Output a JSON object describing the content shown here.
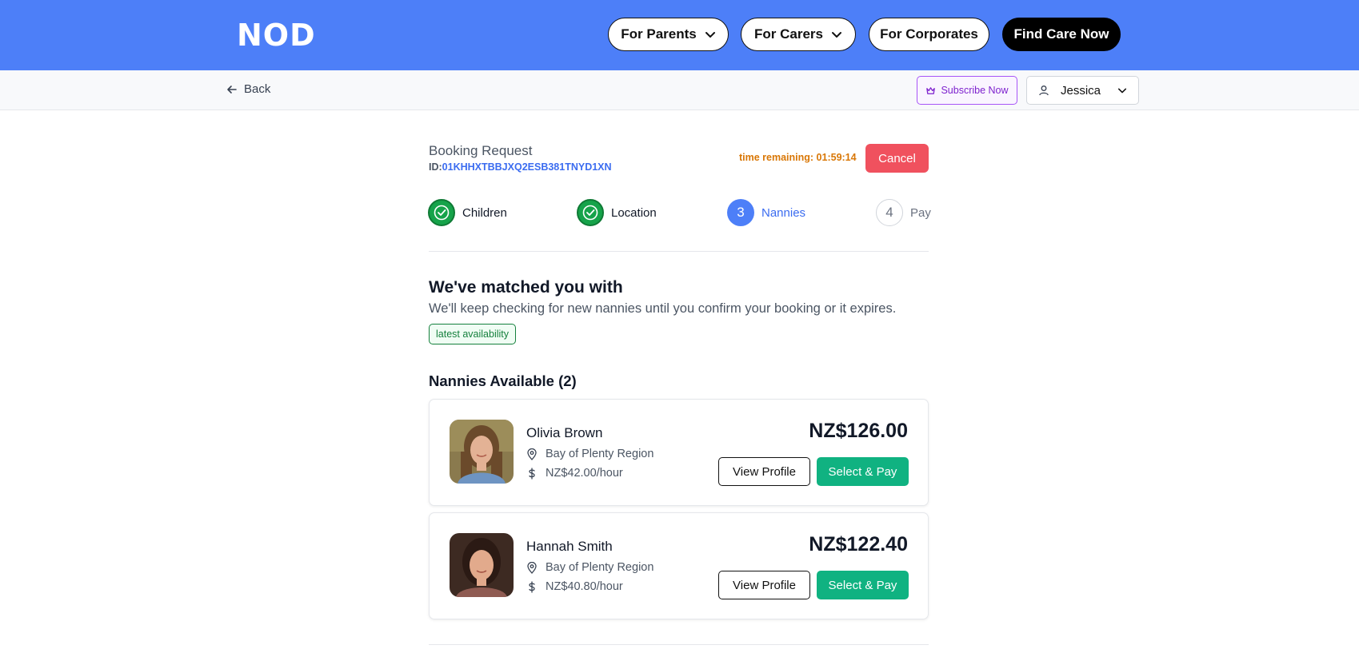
{
  "header": {
    "logo": "NOD",
    "nav": [
      {
        "label": "For Parents"
      },
      {
        "label": "For Carers"
      },
      {
        "label": "For Corporates"
      },
      {
        "label": "Find Care Now"
      }
    ]
  },
  "subbar": {
    "back_label": "Back",
    "subscribe_label": "Subscribe Now",
    "user_name": "Jessica"
  },
  "booking": {
    "title": "Booking Request",
    "id_prefix": "ID:",
    "id": "01KHHXTBBJXQ2ESB381TNYD1XN",
    "time_remaining": "time remaining: 01:59:14",
    "cancel_label": "Cancel"
  },
  "steps": [
    {
      "label": "Children",
      "number": "1",
      "state": "done"
    },
    {
      "label": "Location",
      "number": "2",
      "state": "done"
    },
    {
      "label": "Nannies",
      "number": "3",
      "state": "active"
    },
    {
      "label": "Pay",
      "number": "4",
      "state": "todo"
    }
  ],
  "match": {
    "heading": "We've matched you with",
    "subtext": "We'll keep checking for new nannies until you confirm your booking or it expires.",
    "badge": "latest availability"
  },
  "nannies_heading": "Nannies Available (2)",
  "nannies": [
    {
      "name": "Olivia Brown",
      "region": "Bay of Plenty Region",
      "rate": "NZ$42.00/hour",
      "price": "NZ$126.00",
      "view_label": "View Profile",
      "select_label": "Select & Pay"
    },
    {
      "name": "Hannah Smith",
      "region": "Bay of Plenty Region",
      "rate": "NZ$40.80/hour",
      "price": "NZ$122.40",
      "view_label": "View Profile",
      "select_label": "Select & Pay"
    }
  ],
  "colors": {
    "brand_blue": "#4d7ff8",
    "success_green": "#16a34a",
    "select_green": "#10b281",
    "cancel_red": "#f0515e",
    "timer_orange": "#d97706"
  }
}
